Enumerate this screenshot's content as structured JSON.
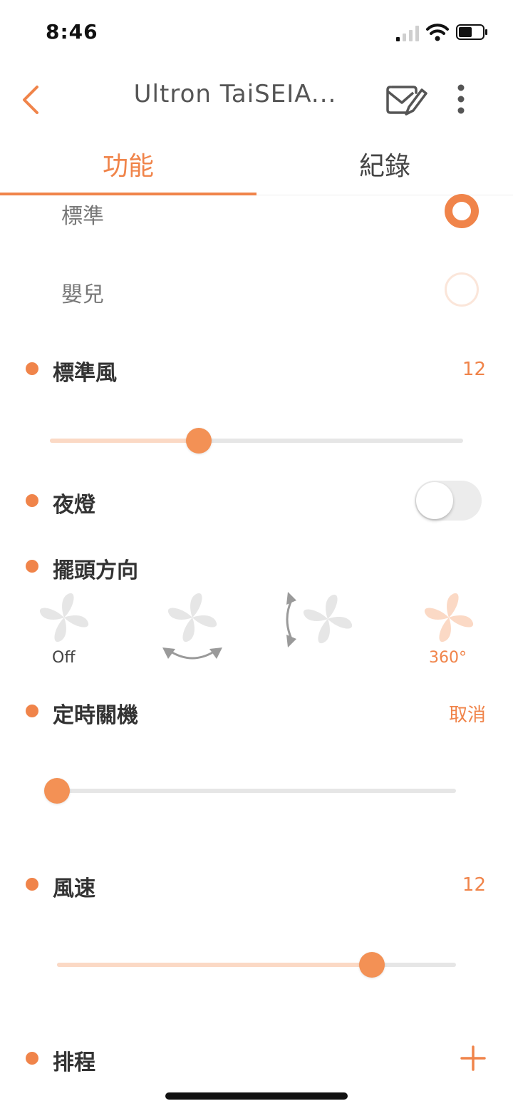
{
  "status_bar": {
    "time": "8:46"
  },
  "header": {
    "title": "Ultron TaiSEIA..."
  },
  "tabs": [
    {
      "label": "功能",
      "active": true
    },
    {
      "label": "紀錄",
      "active": false
    }
  ],
  "modes": [
    {
      "label": "標準",
      "selected": true
    },
    {
      "label": "嬰兒",
      "selected": false
    }
  ],
  "standard_wind": {
    "title": "標準風",
    "value": "12",
    "level": 0.36
  },
  "night_light": {
    "title": "夜燈",
    "on": false
  },
  "swing": {
    "title": "擺頭方向",
    "options": [
      {
        "label": "Off",
        "active": false
      },
      {
        "label": "",
        "active": false
      },
      {
        "label": "",
        "active": false
      },
      {
        "label": "360°",
        "active": true
      }
    ]
  },
  "timer": {
    "title": "定時關機",
    "action": "取消",
    "level": 0.0
  },
  "fan_speed": {
    "title": "風速",
    "value": "12",
    "level": 0.79
  },
  "schedule": {
    "title": "排程"
  },
  "colors": {
    "accent": "#f0844a",
    "accent_light": "#fbd9c5",
    "track": "#e6e6e6"
  }
}
